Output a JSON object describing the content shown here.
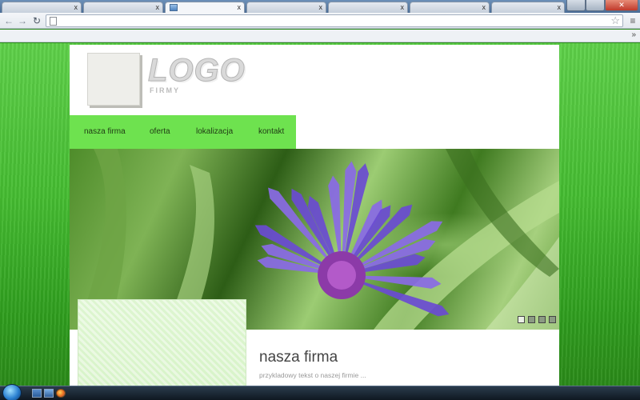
{
  "browser": {
    "tabs": [
      {
        "close": "x"
      },
      {
        "close": "x"
      },
      {
        "close": "x",
        "active": true
      },
      {
        "close": "x"
      },
      {
        "close": "x"
      },
      {
        "close": "x"
      },
      {
        "close": "x"
      }
    ],
    "nav": {
      "back": "←",
      "forward": "→",
      "reload": "↻"
    },
    "address": {
      "value": ""
    },
    "bookmark_star": "☆",
    "menu": "≡",
    "bookmarks_more": "»"
  },
  "site": {
    "logo": {
      "text": "LOGO",
      "subtitle": "FIRMY"
    },
    "menu": [
      {
        "label": "nasza firma"
      },
      {
        "label": "oferta"
      },
      {
        "label": "lokalizacja"
      },
      {
        "label": "kontakt"
      }
    ],
    "slider": {
      "count": 4,
      "current": 1
    },
    "content": {
      "title": "nasza firma",
      "text": "przykladowy tekst o naszej firmie ..."
    }
  },
  "colors": {
    "menu_bg": "#6ee24f",
    "page_bg": "#ffffff",
    "grass_bg": "#45bd31",
    "flower": "#7a5ad8"
  },
  "icons": [
    "page-icon",
    "star-icon",
    "menu-icon",
    "windows-start-icon",
    "show-desktop-icon",
    "switch-windows-icon",
    "firefox-icon"
  ]
}
